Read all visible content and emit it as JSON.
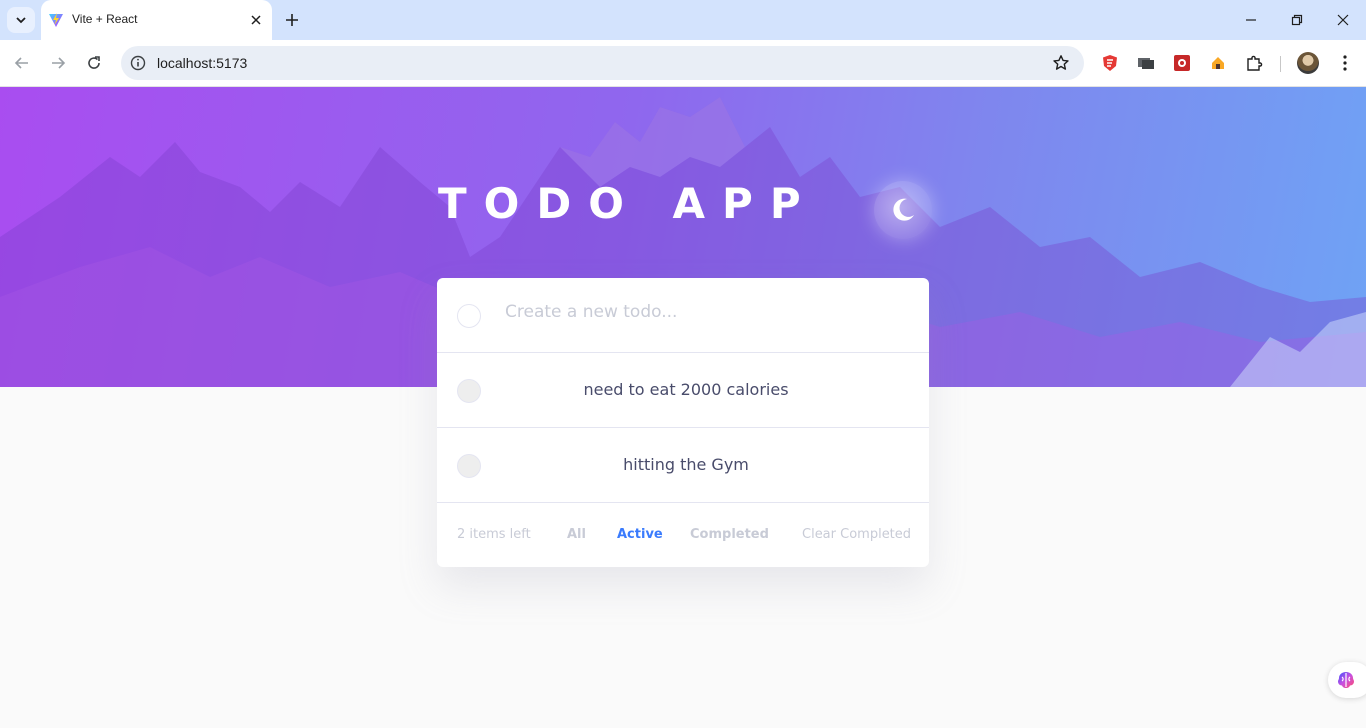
{
  "browser": {
    "tab": {
      "title": "Vite + React"
    },
    "address_bar": {
      "url": "localhost:5173"
    },
    "icons": [
      "tab-search-icon",
      "vite-favicon",
      "close-icon",
      "new-tab-icon",
      "minimize-icon",
      "restore-icon",
      "window-close-icon",
      "back-icon",
      "forward-icon",
      "reload-icon",
      "site-info-icon",
      "bookmark-star-icon",
      "extension-icons",
      "puzzle-icon",
      "profile-avatar",
      "menu-icon"
    ]
  },
  "app": {
    "title": "TODO APP",
    "theme_toggle_icon": "moon-icon",
    "new_todo": {
      "placeholder": "Create a new todo..."
    },
    "todos": [
      {
        "text": "need to eat 2000 calories",
        "completed": false
      },
      {
        "text": "hitting the Gym",
        "completed": false
      }
    ],
    "footer": {
      "items_left": "2 items left",
      "filters": [
        "All",
        "Active",
        "Completed"
      ],
      "active_filter": "Active",
      "clear_label": "Clear Completed"
    },
    "colors": {
      "accent": "#3a7bfd",
      "hero_gradient_start": "#a94df0",
      "hero_gradient_end": "#6fa3f5",
      "text": "#494c6b",
      "muted": "#c8cbd6"
    }
  }
}
